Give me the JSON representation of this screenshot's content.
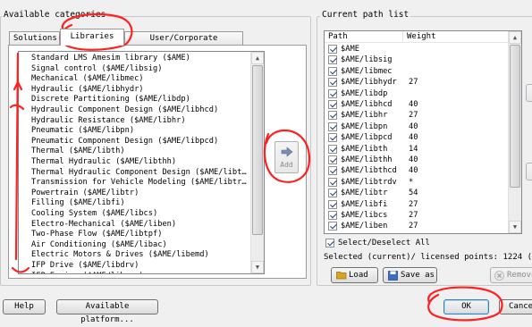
{
  "left_panel": {
    "title": "Available categories",
    "tabs": [
      "Solutions",
      "Libraries",
      "User/Corporate libraries"
    ],
    "categories": [
      "Standard LMS Amesim library ($AME)",
      "Signal control ($AME/libsig)",
      "Mechanical ($AME/libmec)",
      "Hydraulic ($AME/libhydr)",
      "Discrete Partitioning ($AME/libdp)",
      "Hydraulic Component Design ($AME/libhcd)",
      "Hydraulic Resistance ($AME/libhr)",
      "Pneumatic ($AME/libpn)",
      "Pneumatic Component Design ($AME/libpcd)",
      "Thermal ($AME/libth)",
      "Thermal Hydraulic ($AME/libthh)",
      "Thermal Hydraulic Component Design ($AME/libt…",
      "Transmission for Vehicle Modeling ($AME/libtr…",
      "Powertrain ($AME/libtr)",
      "Filling ($AME/libfi)",
      "Cooling System ($AME/libcs)",
      "Electro-Mechanical ($AME/liben)",
      "Two-Phase Flow ($AME/libtpf)",
      "Air Conditioning ($AME/libac)",
      "Electric Motors & Drives ($AME/libemd)",
      "IFP Drive ($AME/libdrv)",
      "IFP Engine ($AME/libeng)"
    ]
  },
  "add_button": {
    "label": "Add",
    "icon": "arrow-right-icon"
  },
  "right_panel": {
    "title": "Current path list",
    "columns": [
      "Path",
      "Weight"
    ],
    "rows": [
      {
        "path": "$AME",
        "weight": "",
        "checked": true
      },
      {
        "path": "$AME/libsig",
        "weight": "",
        "checked": true
      },
      {
        "path": "$AME/libmec",
        "weight": "",
        "checked": true
      },
      {
        "path": "$AME/libhydr",
        "weight": "27",
        "checked": true
      },
      {
        "path": "$AME/libdp",
        "weight": "",
        "checked": true
      },
      {
        "path": "$AME/libhcd",
        "weight": "40",
        "checked": true
      },
      {
        "path": "$AME/libhr",
        "weight": "27",
        "checked": true
      },
      {
        "path": "$AME/libpn",
        "weight": "40",
        "checked": true
      },
      {
        "path": "$AME/libpcd",
        "weight": "40",
        "checked": true
      },
      {
        "path": "$AME/libth",
        "weight": "14",
        "checked": true
      },
      {
        "path": "$AME/libthh",
        "weight": "40",
        "checked": true
      },
      {
        "path": "$AME/libthcd",
        "weight": "40",
        "checked": true
      },
      {
        "path": "$AME/libtrdv",
        "weight": "*",
        "checked": true
      },
      {
        "path": "$AME/libtr",
        "weight": "54",
        "checked": true
      },
      {
        "path": "$AME/libfi",
        "weight": "27",
        "checked": true
      },
      {
        "path": "$AME/libcs",
        "weight": "27",
        "checked": true
      },
      {
        "path": "$AME/liben",
        "weight": "27",
        "checked": true
      }
    ],
    "select_all_label": "Select/Deselect All",
    "points_text": "Selected (current)/ licensed points: 1224 (0)/10",
    "load_label": "Load",
    "save_label": "Save as",
    "remove_label": "Remove"
  },
  "footer": {
    "help_label": "Help",
    "platform_label": "Available platform...",
    "ok_label": "OK",
    "cancel_label": "Cance"
  },
  "colors": {
    "annotation": "#ff2020",
    "add_arrow": "#7a8fb0",
    "load_icon": "#d8a520",
    "save_icon": "#3a6fc0",
    "remove_icon": "#b0b0b0"
  }
}
